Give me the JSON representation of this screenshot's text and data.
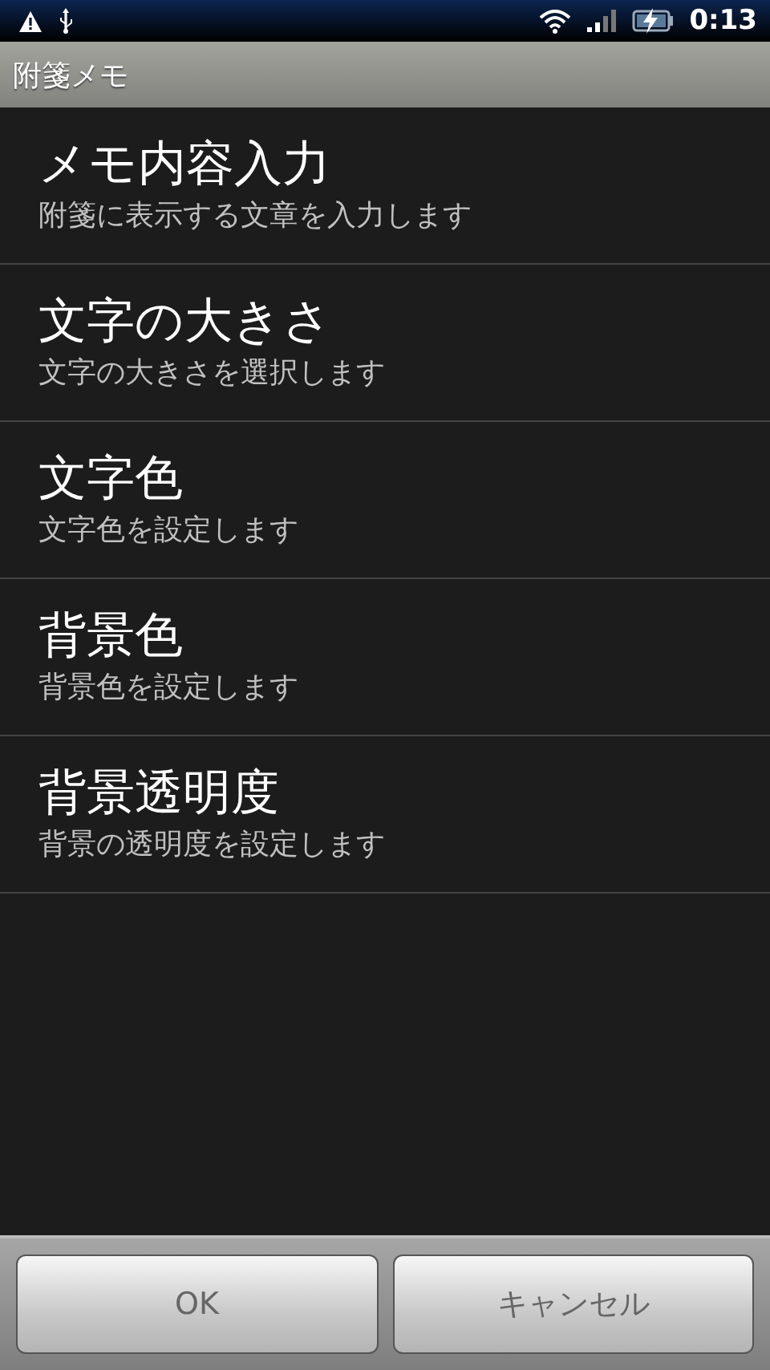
{
  "status_bar": {
    "time": "0:13"
  },
  "title_bar": {
    "title": "附箋メモ"
  },
  "settings": [
    {
      "title": "メモ内容入力",
      "summary": "附箋に表示する文章を入力します"
    },
    {
      "title": "文字の大きさ",
      "summary": "文字の大きさを選択します"
    },
    {
      "title": "文字色",
      "summary": "文字色を設定します"
    },
    {
      "title": "背景色",
      "summary": "背景色を設定します"
    },
    {
      "title": "背景透明度",
      "summary": "背景の透明度を設定します"
    }
  ],
  "buttons": [
    "OK",
    "キャンセル"
  ]
}
